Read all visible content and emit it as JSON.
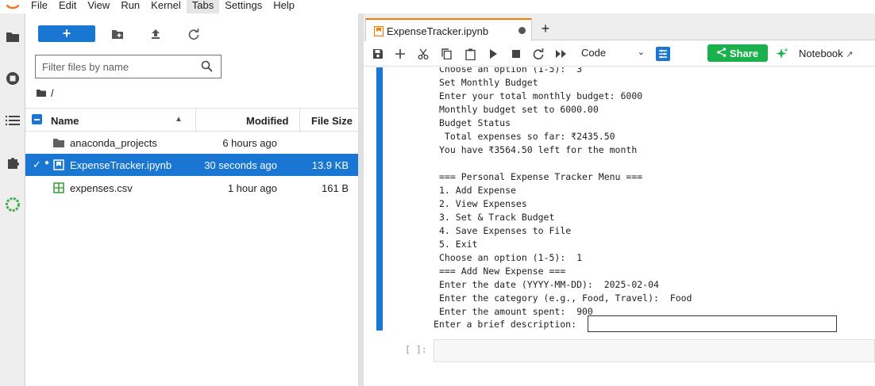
{
  "menubar": {
    "items": [
      "File",
      "Edit",
      "View",
      "Run",
      "Kernel",
      "Tabs",
      "Settings",
      "Help"
    ],
    "active": "Tabs"
  },
  "filebrowser": {
    "new_label": "+",
    "filter_placeholder": "Filter files by name",
    "breadcrumb": "/",
    "columns": {
      "name": "Name",
      "modified": "Modified",
      "size": "File Size"
    },
    "files": [
      {
        "name": "anaconda_projects",
        "modified": "6 hours ago",
        "size": "",
        "icon": "folder-icon",
        "selected": false
      },
      {
        "name": "ExpenseTracker.ipynb",
        "modified": "30 seconds ago",
        "size": "13.9 KB",
        "icon": "notebook-icon",
        "selected": true
      },
      {
        "name": "expenses.csv",
        "modified": "1 hour ago",
        "size": "161 B",
        "icon": "spreadsheet-icon",
        "selected": false
      }
    ]
  },
  "notebook": {
    "tab_title": "ExpenseTracker.ipynb",
    "cell_type": "Code",
    "share_label": "Share",
    "notebook_label": "Notebook",
    "output_lines": [
      "Choose an option (1-5):  3",
      "Set Monthly Budget",
      "Enter your total monthly budget: 6000",
      "Monthly budget set to 6000.00",
      "Budget Status",
      " Total expenses so far: ₹2435.50",
      "You have ₹3564.50 left for the month",
      "",
      "=== Personal Expense Tracker Menu ===",
      "1. Add Expense",
      "2. View Expenses",
      "3. Set & Track Budget",
      "4. Save Expenses to File",
      "5. Exit",
      "Choose an option (1-5):  1",
      "=== Add New Expense ===",
      "Enter the date (YYYY-MM-DD):  2025-02-04",
      "Enter the category (e.g., Food, Travel):  Food",
      "Enter the amount spent:  900"
    ],
    "stdin_prompt": "Enter a brief description: ",
    "stdin_value": "",
    "next_prompt": "[ ]:"
  },
  "colors": {
    "accent": "#1976d2",
    "share": "#1ab04c",
    "tab_top": "#f57c00"
  }
}
